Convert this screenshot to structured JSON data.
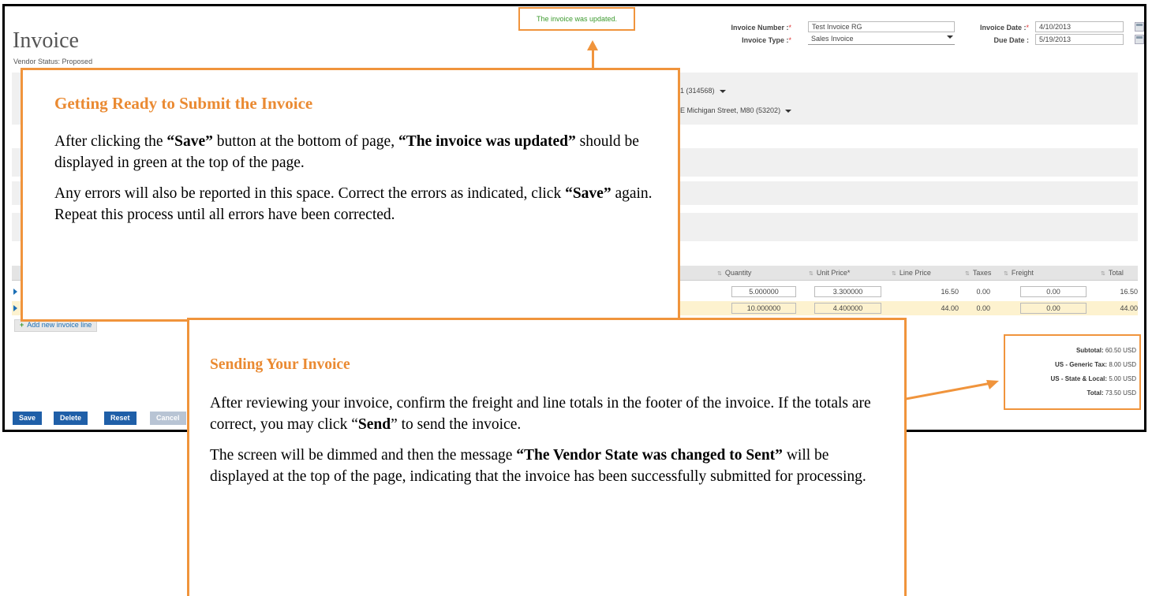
{
  "header": {
    "title": "Invoice",
    "vendor_status": "Vendor Status: Proposed",
    "success_message": "The invoice was updated."
  },
  "form": {
    "invoice_number_label": "Invoice Number :",
    "invoice_number_value": "Test Invoice RG",
    "invoice_type_label": "Invoice Type :",
    "invoice_type_value": "Sales Invoice",
    "invoice_date_label": "Invoice Date :",
    "invoice_date_value": "4/10/2013",
    "due_date_label": "Due Date :",
    "due_date_value": "5/19/2013",
    "required_mark": "*"
  },
  "panel": {
    "vendor_fragment": "1 (314568)",
    "address_fragment": "E Michigan Street, M80 (53202)"
  },
  "grid": {
    "columns": [
      "Quantity",
      "Unit Price*",
      "Line Price",
      "Taxes",
      "Freight",
      "Total"
    ],
    "rows": [
      {
        "quantity": "5.000000",
        "unit_price": "3.300000",
        "line_price": "16.50",
        "taxes": "0.00",
        "freight": "0.00",
        "total": "16.50"
      },
      {
        "quantity": "10.000000",
        "unit_price": "4.400000",
        "line_price": "44.00",
        "taxes": "0.00",
        "freight": "0.00",
        "total": "44.00"
      }
    ],
    "add_line_label": "Add new invoice line"
  },
  "totals": {
    "subtotal_label": "Subtotal:",
    "subtotal_value": "60.50 USD",
    "generic_tax_label": "US - Generic Tax:",
    "generic_tax_value": "8.00 USD",
    "state_local_label": "US - State & Local:",
    "state_local_value": "5.00 USD",
    "total_label": "Total:",
    "total_value": "73.50 USD"
  },
  "buttons": {
    "save": "Save",
    "delete": "Delete",
    "reset": "Reset",
    "cancel": "Cancel"
  },
  "callout_submit": {
    "title": "Getting Ready to Submit the Invoice",
    "p1_a": "After clicking the ",
    "p1_save": "“Save”",
    "p1_b": " button at the bottom of page, ",
    "p1_msg": "“The invoice was updated”",
    "p1_c": " should be displayed in green at the top of the page.",
    "p2_a": "Any errors will also be reported in this space. Correct the errors as indicated, click ",
    "p2_save": "“Save”",
    "p2_b": " again. Repeat this process until all errors have been corrected."
  },
  "callout_send": {
    "title": "Sending Your Invoice",
    "p1_a": "After reviewing your invoice, confirm the freight and line totals in the footer of the invoice. If the totals are correct, you may click “",
    "p1_send": "Send",
    "p1_b": "” to send the invoice.",
    "p2_a": "The screen will be dimmed and then the message ",
    "p2_msg": "“The Vendor State was changed to Sent”",
    "p2_b": " will be displayed at the top of the page, indicating that the invoice has been successfully submitted for processing."
  },
  "colors": {
    "callout_border": "#f0943c",
    "callout_title": "#ea8a32",
    "success_text": "#3c9a2e",
    "button_blue": "#1f5fa8"
  }
}
